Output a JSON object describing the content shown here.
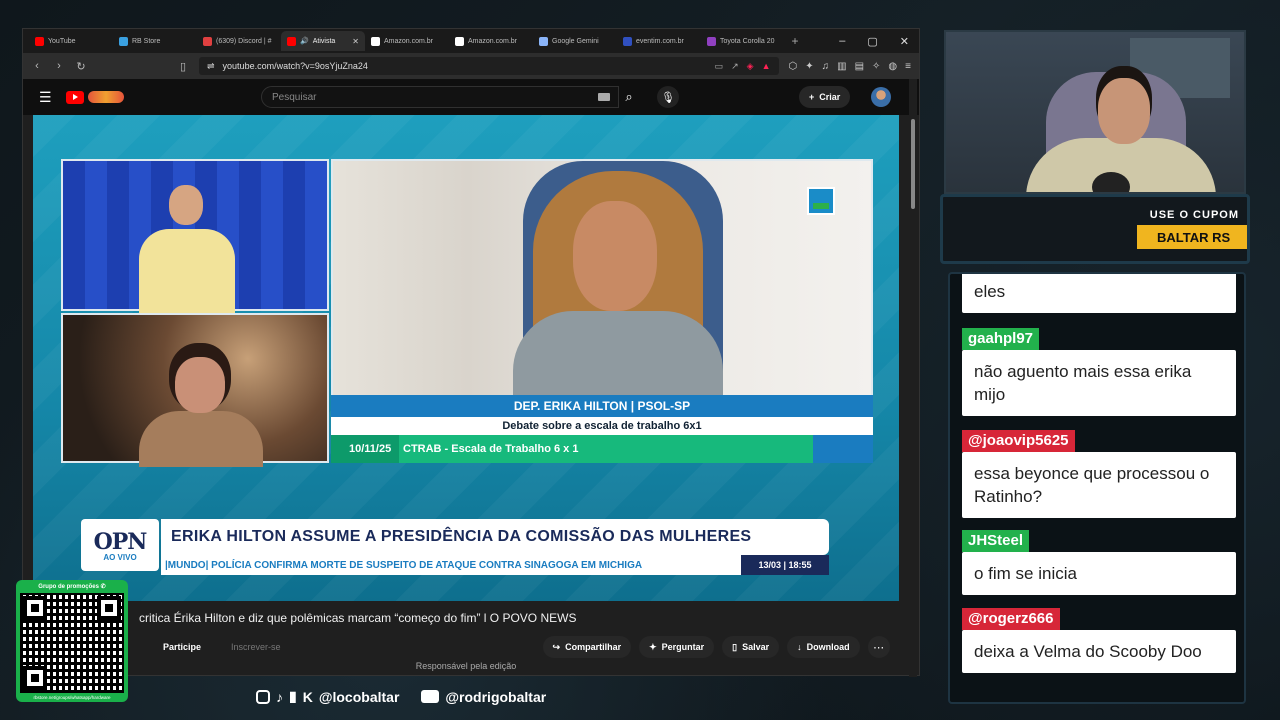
{
  "browser": {
    "tabs": [
      {
        "label": "YouTube",
        "color": "#ff0000"
      },
      {
        "label": "RB Store",
        "color": "#3aa0e0"
      },
      {
        "label": "(6309) Discord | #",
        "color": "#e04040"
      },
      {
        "label": "Ativista",
        "color": "#ff0000",
        "active": true
      },
      {
        "label": "Amazon.com.br",
        "color": "#ffffff"
      },
      {
        "label": "Amazon.com.br",
        "color": "#ffffff"
      },
      {
        "label": "Google Gemini",
        "color": "#8ab4f8"
      },
      {
        "label": "eventim.com.br",
        "color": "#3050c0"
      },
      {
        "label": "Toyota Corolla 20",
        "color": "#9040c0"
      }
    ],
    "url": "youtube.com/watch?v=9osYjuZna24"
  },
  "youtube": {
    "search_placeholder": "Pesquisar",
    "create_label": "Criar",
    "video_title": "critica Érika Hilton e diz que polêmicas marcam “começo do fim” l O POVO NEWS",
    "join_label": "Participe",
    "subscribe_label": "Inscrever-se",
    "share_label": "Compartilhar",
    "ask_label": "Perguntar",
    "save_label": "Salvar",
    "download_label": "Download",
    "responsible": "Responsável pela edição"
  },
  "broadcast": {
    "name_tag": "DEP. ERIKA HILTON | PSOL-SP",
    "subject": "Debate sobre a escala de trabalho 6x1",
    "date": "10/11/25",
    "topic": "CTRAB - Escala de Trabalho 6 x 1",
    "logo": "OPN",
    "live_label": "AO VIVO",
    "headline": "ERIKA HILTON ASSUME A PRESIDÊNCIA DA COMISSÃO DAS MULHERES",
    "ticker": "|MUNDO| POLÍCIA CONFIRMA MORTE DE SUSPEITO DE ATAQUE CONTRA SINAGOGA EM MICHIGA",
    "timestamp": "13/03 | 18:55"
  },
  "overlay": {
    "promo_top": "USE O CUPOM",
    "promo_bottom": "BALTAR RS",
    "qr_title": "Grupo de promoções",
    "qr_url": "rbstore.net/groups/whatsapp/hardware",
    "social_handle": "@locobaltar",
    "youtube_handle": "@rodrigobaltar"
  },
  "chat": [
    {
      "user": "",
      "message": "eles",
      "color": "#ffffff"
    },
    {
      "user": "gaahpl97",
      "message": "não aguento mais essa erika mijo",
      "color": "#22b14c"
    },
    {
      "user": "@joaovip5625",
      "message": "essa beyonce que processou o Ratinho?",
      "color": "#d72638"
    },
    {
      "user": "JHSteel",
      "message": "o fim se inicia",
      "color": "#22b14c"
    },
    {
      "user": "@rogerz666",
      "message": "deixa a Velma do Scooby Doo",
      "color": "#d72638"
    }
  ]
}
